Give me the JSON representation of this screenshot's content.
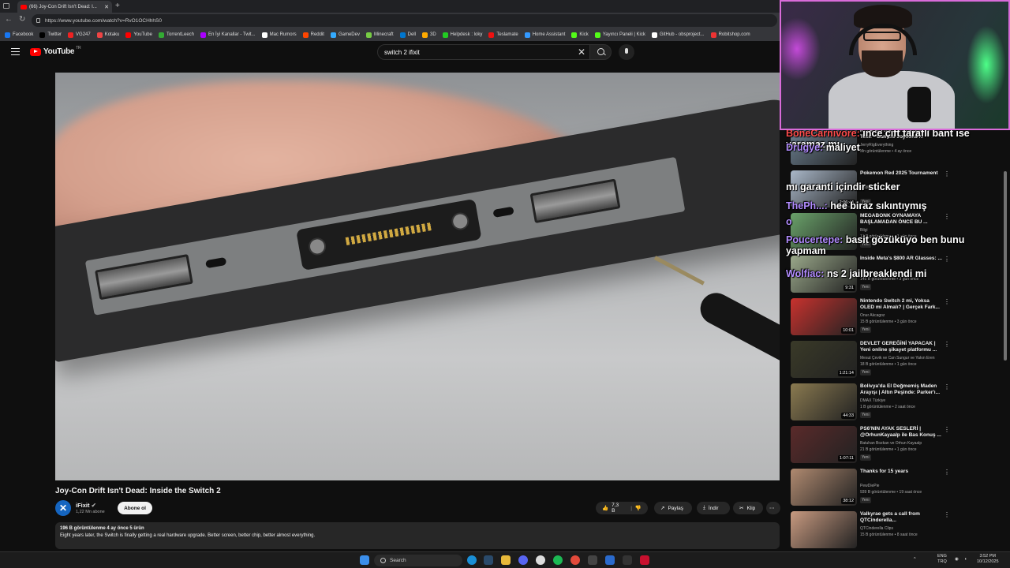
{
  "browser": {
    "tab_title": "(66) Joy-Con Drift Isn't Dead: I...",
    "url": "https://www.youtube.com/watch?v=RvO1OCHhhS0",
    "bookmarks": [
      "Facebook",
      "Twitter",
      "VG247",
      "Kotaku",
      "YouTube",
      "TorrentLeech",
      "En İyi Kanallar - Twit...",
      "Mac Rumors",
      "Reddit",
      "GameDev",
      "Minecraft",
      "Dell",
      "3D",
      "Helpdesk : loky",
      "Teslamate",
      "Home Assistant",
      "Kick",
      "Yayıncı Paneli | Kick",
      "GitHub - obsproject...",
      "Robitshop.com"
    ]
  },
  "youtube": {
    "logo": "YouTube",
    "logo_sup": "TR",
    "search_value": "switch 2 ifixit"
  },
  "video": {
    "title": "Joy-Con Drift Isn't Dead: Inside the Switch 2",
    "channel": "iFixit",
    "subs": "1,22 Mn abone",
    "subscribe": "Abone ol",
    "likes": "7,3 B",
    "share": "Paylaş",
    "download": "İndir",
    "clip": "Klip",
    "stats": "196 B görüntülenme  4 ay önce  5 ürün",
    "description": "Eight years later, the Switch is finally getting a real hardware upgrade. Better screen, better chip, better almost everything."
  },
  "sidebar": [
    {
      "title": "Nintendo Switch 2 Durability Test! - Can the Joycons ...",
      "channel": "JerryRigEverything",
      "meta": "Mn görüntülenme  •  4 ay önce",
      "duration": "",
      "new": "",
      "color": "#6b7f90"
    },
    {
      "title": "Pokemon Red 2025 Tournament",
      "channel": "RedRageTV",
      "meta": "",
      "duration": "2:06:44",
      "new": "Yeni",
      "color": "#a9b7c8"
    },
    {
      "title": "MEGABONK OYNAMAYA BAŞLAMADAN ÖNCE BU ...",
      "channel": "Bilgi",
      "meta": "12 B görüntülenme  •  1 gün önce",
      "duration": "",
      "new": "Yeni",
      "color": "#6aa26a"
    },
    {
      "title": "Inside Meta's $800 AR Glasses: ...",
      "channel": "iFixit",
      "meta": "145 B görüntülenme  •  3 gün önce",
      "duration": "9:31",
      "new": "Yeni",
      "color": "#9aa88a"
    },
    {
      "title": "Nintendo Switch 2 mi, Yoksa OLED mi Almalı? | Gerçek Fark...",
      "channel": "Onur Akcagoz",
      "meta": "15 B görüntülenme  •  3 gün önce",
      "duration": "10:01",
      "new": "Yeni",
      "color": "#c8322e"
    },
    {
      "title": "DEVLET GEREĞİNİ YAPACAK | Yeni online şikayet platformu ...",
      "channel": "Mesut Çevik ve Can Sungur ve Yakın Eren",
      "meta": "18 B görüntülenme  •  1 gün önce",
      "duration": "1:21:14",
      "new": "Yeni",
      "color": "#3a3a28"
    },
    {
      "title": "Bolivya'da El Değmemiş Maden Arayışı | Altın Peşinde: Parker'ı...",
      "channel": "DMAX Türkiye",
      "meta": "1 B görüntülenme  •  2 saat önce",
      "duration": "44:33",
      "new": "Yeni",
      "color": "#8a7a50"
    },
    {
      "title": "PS6'NIN AYAK SESLERİ | @OrhunKayaalp ile Bas Konuş ...",
      "channel": "Batuhan Bozkan ve Orhun Kayaalp",
      "meta": "21 B görüntülenme  •  1 gün önce",
      "duration": "1:07:11",
      "new": "Yeni",
      "color": "#5a2a2a"
    },
    {
      "title": "Thanks for 15 years",
      "channel": "PewDiePie",
      "meta": "939 B görüntülenme  •  19 saat önce",
      "duration": "38:12",
      "new": "Yeni",
      "color": "#b08a70"
    },
    {
      "title": "Valkyrae gets a call from QTCinderella...",
      "channel": "QTCinderella Clips",
      "meta": "15 B görüntülenme  •  8 saat önce",
      "duration": "",
      "new": "",
      "color": "#c89a80"
    }
  ],
  "chat": [
    {
      "user": "BoneCarnivore:",
      "text": "ince çift taraflı bant ise yaramaz mı"
    },
    {
      "user": "Drugye:",
      "text": "maliyet"
    },
    {
      "user": "",
      "text": "mı garanti içindir sticker"
    },
    {
      "user": "ThePh...:",
      "text": "hee biraz sıkıntıymış"
    },
    {
      "user": "o",
      "text": ""
    },
    {
      "user": "Poucertepe:",
      "text": "basit gözüküyo ben bunu yapmam"
    },
    {
      "user": "Wolfiac:",
      "text": "ns 2 jailbreaklendi mi"
    }
  ],
  "taskbar": {
    "search": "Search",
    "lang1": "ENG",
    "lang2": "TRQ",
    "time": "3:52 PM",
    "date": "10/12/2025"
  }
}
